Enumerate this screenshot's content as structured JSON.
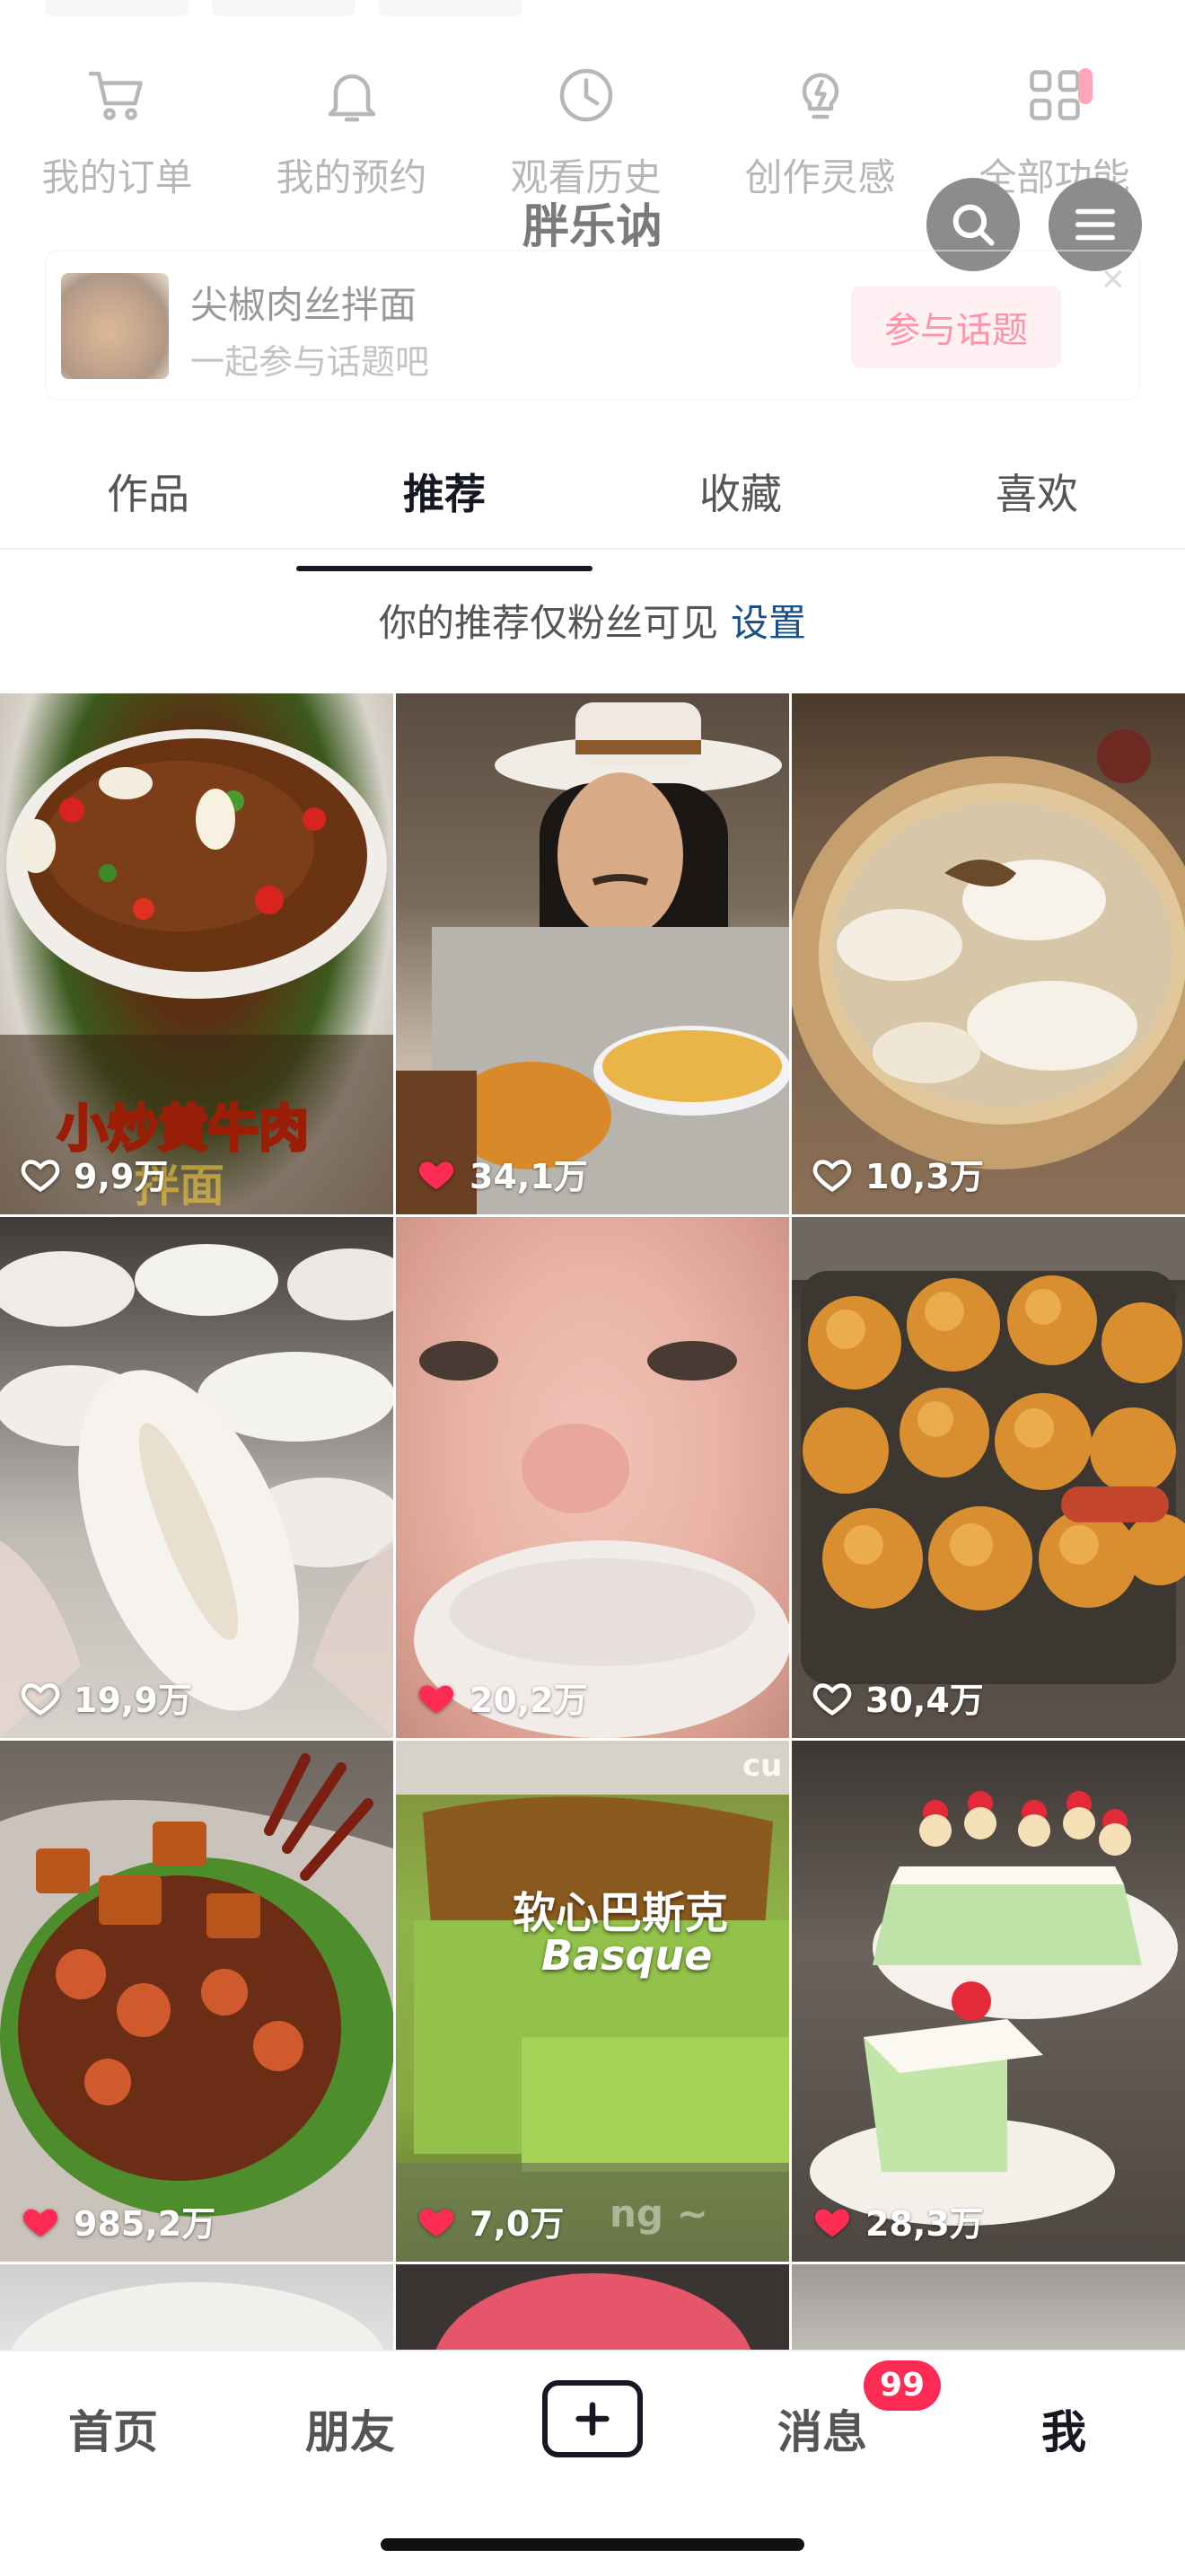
{
  "quick_actions": [
    {
      "label": "我的订单",
      "icon": "cart-icon"
    },
    {
      "label": "我的预约",
      "icon": "bell-icon"
    },
    {
      "label": "观看历史",
      "icon": "clock-icon"
    },
    {
      "label": "创作灵感",
      "icon": "lightbulb-icon"
    },
    {
      "label": "全部功能",
      "icon": "grid-icon"
    }
  ],
  "header": {
    "title": "胖乐讷"
  },
  "topic_card": {
    "title": "尖椒肉丝拌面",
    "subtitle": "一起参与话题吧",
    "button": "参与话题"
  },
  "tabs": [
    {
      "label": "作品"
    },
    {
      "label": "推荐",
      "active": true
    },
    {
      "label": "收藏"
    },
    {
      "label": "喜欢"
    }
  ],
  "notice": {
    "text": "你的推荐仅粉丝可见",
    "link": "设置"
  },
  "grid": [
    {
      "likes": "9,9万",
      "liked": false,
      "overlay": "小炒黄牛肉",
      "overlay2": "拌面"
    },
    {
      "likes": "34,1万",
      "liked": true
    },
    {
      "likes": "10,3万",
      "liked": false
    },
    {
      "likes": "19,9万",
      "liked": false
    },
    {
      "likes": "20,2万",
      "liked": true
    },
    {
      "likes": "30,4万",
      "liked": false
    },
    {
      "likes": "985,2万",
      "liked": true
    },
    {
      "likes": "7,0万",
      "liked": true,
      "overlay": "软心巴斯克",
      "overlay2": "Basque",
      "overlay3": "ng ~",
      "corner": "cu"
    },
    {
      "likes": "28,3万",
      "liked": true
    }
  ],
  "bottom_nav": {
    "home": "首页",
    "friends": "朋友",
    "messages": "消息",
    "me": "我",
    "message_count": "99"
  },
  "colors": {
    "accent": "#fe2c55",
    "link": "#1b4f8a",
    "text": "#161823"
  }
}
